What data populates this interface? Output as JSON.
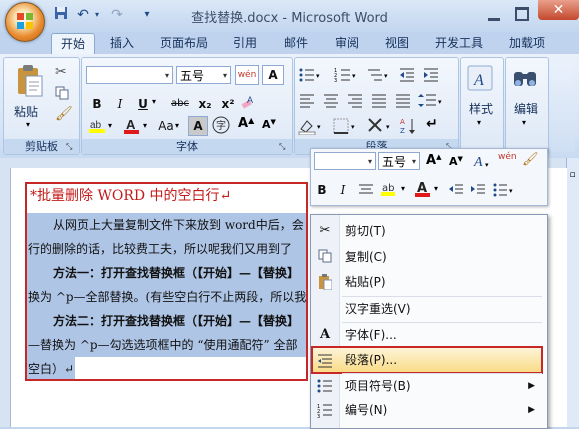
{
  "window": {
    "title": "查找替换.docx - Microsoft Word"
  },
  "qat": {
    "save_icon": "save-icon",
    "undo_icon": "undo-icon",
    "redo_icon": "redo-icon",
    "customize_icon": "customize-qat-icon"
  },
  "tabs": [
    "开始",
    "插入",
    "页面布局",
    "引用",
    "邮件",
    "审阅",
    "视图",
    "开发工具",
    "加载项"
  ],
  "active_tab": "开始",
  "ribbon": {
    "clipboard": {
      "label": "剪贴板",
      "paste_label": "粘贴"
    },
    "font": {
      "label": "字体",
      "font_name": "",
      "font_size": "五号",
      "wen_label": "wén",
      "bold": "B",
      "italic": "I",
      "underline": "U",
      "strike": "abc",
      "sub": "x₂",
      "sup": "x²",
      "aa_label": "Aa",
      "A_label": "A"
    },
    "paragraph": {
      "label": "段落"
    },
    "styles": {
      "label": "样式"
    },
    "editing": {
      "label": "编辑"
    }
  },
  "mini_toolbar": {
    "font_name": "",
    "font_size": "五号",
    "bold": "B",
    "italic": "I",
    "A_label": "A",
    "wen_label": "wén"
  },
  "document": {
    "heading": "*批量删除 WORD 中的空白行↵",
    "lines": [
      "从网页上大量复制文件下来放到 word中后，会",
      "行的删除的话，比较费工夫，所以呢我们又用到了",
      "方法一：打开查找替换框（【开始】—【替换】",
      "换为 ^p—全部替换。(有些空白行不止两段，所以我",
      "方法二：打开查找替换框（【开始】—【替换】",
      "—替换为 ^p—勾选选项框中的 “使用通配符” 全部",
      "空白）↵"
    ]
  },
  "context_menu": {
    "items": [
      {
        "label": "剪切(T)",
        "icon": "scissors-icon",
        "submenu": false
      },
      {
        "label": "复制(C)",
        "icon": "copy-icon",
        "submenu": false
      },
      {
        "label": "粘贴(P)",
        "icon": "paste-icon",
        "submenu": false
      },
      {
        "label": "汉字重选(V)",
        "icon": "",
        "submenu": false
      },
      {
        "label": "字体(F)...",
        "icon": "font-icon",
        "submenu": false
      },
      {
        "label": "段落(P)...",
        "icon": "paragraph-icon",
        "submenu": false
      },
      {
        "label": "项目符号(B)",
        "icon": "bullets-icon",
        "submenu": true
      },
      {
        "label": "编号(N)",
        "icon": "numbering-icon",
        "submenu": true
      }
    ],
    "highlighted": "段落(P)..."
  },
  "colors": {
    "accent_red": "#c62828",
    "ribbon_blue": "#c3d6ec",
    "selection": "#aec5e6"
  }
}
